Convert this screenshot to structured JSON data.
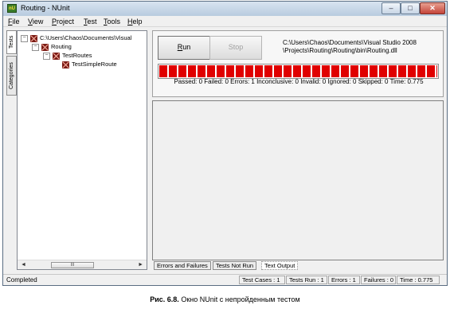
{
  "window": {
    "title": "Routing - NUnit",
    "app_icon_label": "nU",
    "minimize": "–",
    "maximize": "□",
    "close": "✕"
  },
  "menu": [
    {
      "label": "File",
      "mnemonic": "F",
      "rest": "ile"
    },
    {
      "label": "View",
      "mnemonic": "V",
      "rest": "iew"
    },
    {
      "label": "Project",
      "mnemonic": "P",
      "rest": "roject"
    },
    {
      "label": "Test",
      "mnemonic": "T",
      "rest": "est"
    },
    {
      "label": "Tools",
      "mnemonic": "T",
      "rest": "ools"
    },
    {
      "label": "Help",
      "mnemonic": "H",
      "rest": "elp"
    }
  ],
  "side_tabs": {
    "tests": "Tests",
    "categories": "Categories"
  },
  "tree": {
    "nodes": [
      {
        "label": "C:\\Users\\Chaos\\Documents\\Visual",
        "expander": "−"
      },
      {
        "label": "Routing",
        "expander": "−"
      },
      {
        "label": "TestRoutes",
        "expander": "−"
      },
      {
        "label": "TestSimpleRoute",
        "expander": ""
      }
    ],
    "scroll_left": "◄",
    "scroll_right": "►",
    "scroll_thumb": "III"
  },
  "run_panel": {
    "run_label": "Run",
    "run_mnemonic": "R",
    "run_rest": "un",
    "stop_label": "Stop",
    "assembly_path_line1": "C:\\Users\\Chaos\\Documents\\Visual Studio 2008",
    "assembly_path_line2": "\\Projects\\Routing\\Routing\\bin\\Routing.dll",
    "progress": 1.0,
    "progress_color": "#e00000",
    "summary": "Passed: 0 Failed: 0 Errors: 1 Inconclusive: 0 Invalid: 0 Ignored: 0 Skipped: 0 Time: 0.775"
  },
  "bottom_tabs": [
    {
      "label": "Errors and Failures"
    },
    {
      "label": "Tests Not Run"
    },
    {
      "label": "Text Output"
    }
  ],
  "status": {
    "text": "Completed",
    "panes": [
      {
        "text": "Test Cases : 1"
      },
      {
        "text": "Tests Run : 1"
      },
      {
        "text": "Errors : 1"
      },
      {
        "text": "Failures : 0"
      },
      {
        "text": "Time : 0.775"
      }
    ]
  },
  "caption": {
    "prefix": "Рис. 6.8.",
    "text": "Окно NUnit с непройденным тестом"
  }
}
